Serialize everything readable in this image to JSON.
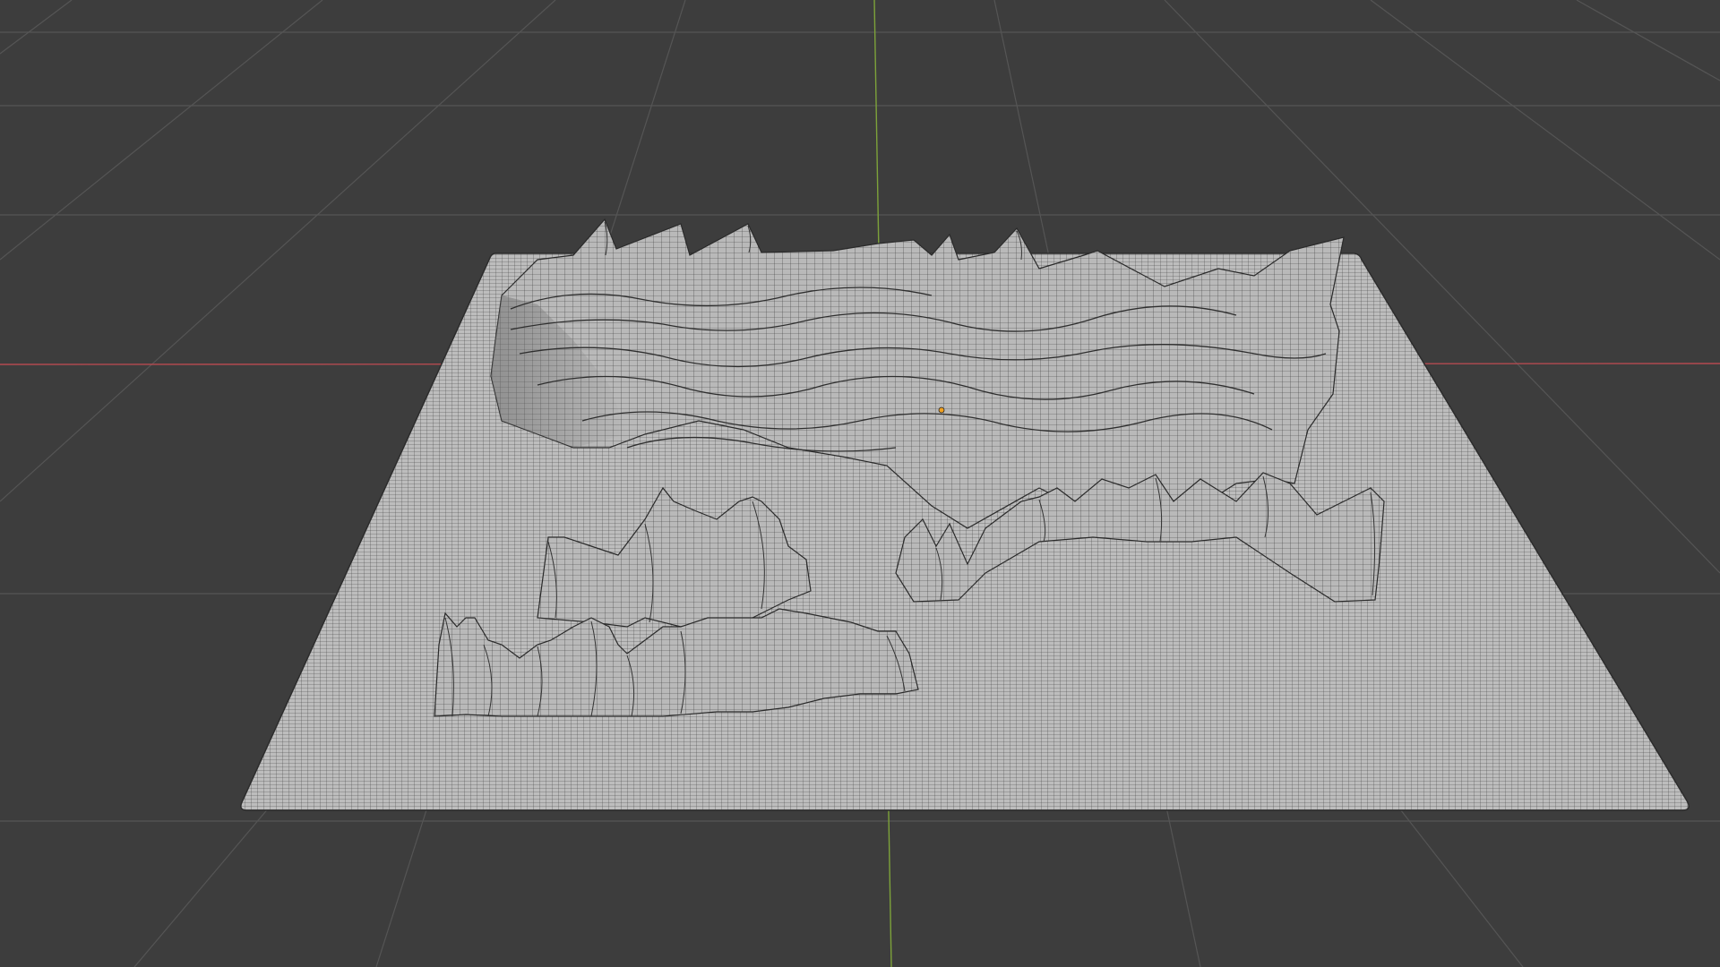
{
  "viewport": {
    "background": "#3d3d3d",
    "grid_color": "#555555",
    "x_axis_color": "#b44a50",
    "y_axis_color": "#7da23a",
    "mesh_fill": "#b9b9b9",
    "mesh_wire": "#2a2a2a",
    "origin_color": "#f0a020"
  },
  "scene_object": {
    "type": "terrain-plane-mesh",
    "icon": "mesh-icon"
  }
}
